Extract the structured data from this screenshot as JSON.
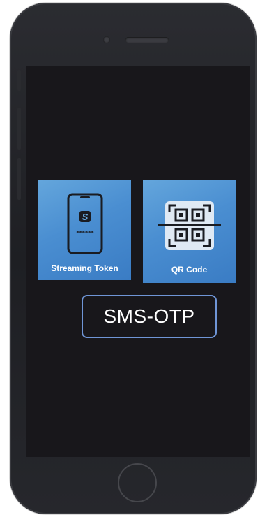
{
  "tiles": {
    "streaming_token": {
      "label": "Streaming Token",
      "masked_code": "******",
      "app_glyph": "S"
    },
    "qr_code": {
      "label": "QR Code"
    }
  },
  "sms_otp": {
    "label": "SMS-OTP"
  },
  "colors": {
    "tile_blue": "#4a8ed1",
    "screen_bg": "#18171b",
    "button_border": "#6f95d6",
    "phone_body": "#26272c"
  },
  "icons": [
    "phone-token-icon",
    "qr-scan-icon"
  ]
}
